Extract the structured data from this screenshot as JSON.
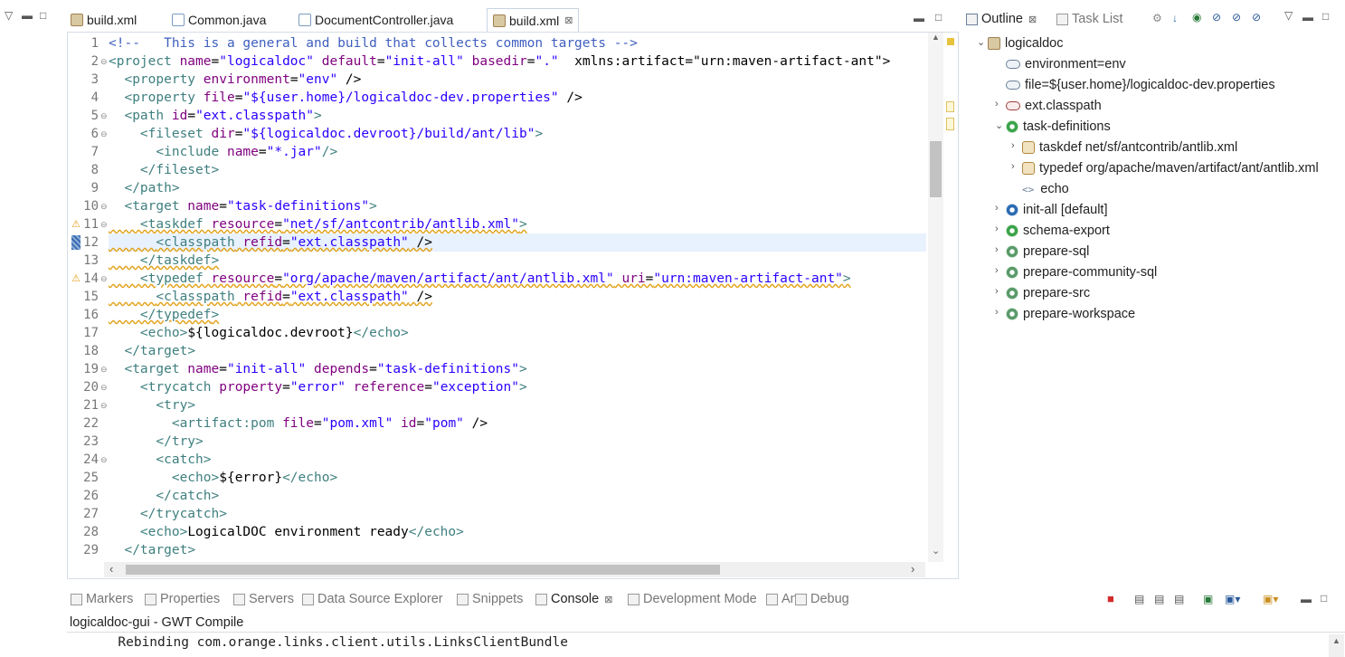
{
  "editor_tabs": [
    {
      "label": "build.xml",
      "icon": "ant-xml-icon"
    },
    {
      "label": "Common.java",
      "icon": "java-file-icon"
    },
    {
      "label": "DocumentController.java",
      "icon": "java-file-icon"
    },
    {
      "label": "build.xml",
      "icon": "ant-xml-icon",
      "active": true,
      "close": "⊠"
    }
  ],
  "line_numbers": [
    "1",
    "2",
    "3",
    "4",
    "5",
    "6",
    "7",
    "8",
    "9",
    "10",
    "11",
    "12",
    "13",
    "14",
    "15",
    "16",
    "17",
    "18",
    "19",
    "20",
    "21",
    "22",
    "23",
    "24",
    "25",
    "26",
    "27",
    "28",
    "29"
  ],
  "code_lines": [
    "<!--   This is a general and build that collects common targets -->",
    "<project name=\"logicaldoc\" default=\"init-all\" basedir=\".\"  xmlns:artifact=\"urn:maven-artifact-ant\">",
    "  <property environment=\"env\" />",
    "  <property file=\"${user.home}/logicaldoc-dev.properties\" />",
    "  <path id=\"ext.classpath\">",
    "    <fileset dir=\"${logicaldoc.devroot}/build/ant/lib\">",
    "      <include name=\"*.jar\"/>",
    "    </fileset>",
    "  </path>",
    "  <target name=\"task-definitions\">",
    "    <taskdef resource=\"net/sf/antcontrib/antlib.xml\">",
    "      <classpath refid=\"ext.classpath\" />",
    "    </taskdef>",
    "    <typedef resource=\"org/apache/maven/artifact/ant/antlib.xml\" uri=\"urn:maven-artifact-ant\">",
    "      <classpath refid=\"ext.classpath\" />",
    "    </typedef>",
    "    <echo>${logicaldoc.devroot}</echo>",
    "  </target>",
    "  <target name=\"init-all\" depends=\"task-definitions\">",
    "    <trycatch property=\"error\" reference=\"exception\">",
    "      <try>",
    "        <artifact:pom file=\"pom.xml\" id=\"pom\" />",
    "      </try>",
    "      <catch>",
    "        <echo>${error}</echo>",
    "      </catch>",
    "    </trycatch>",
    "    <echo>LogicalDOC environment ready</echo>",
    "  </target>"
  ],
  "outline": {
    "tab_label": "Outline",
    "tab_close": "⊠",
    "task_list_label": "Task List",
    "root": "logicaldoc",
    "items": [
      {
        "label": "environment=env",
        "kind": "property"
      },
      {
        "label": "file=${user.home}/logicaldoc-dev.properties",
        "kind": "property"
      },
      {
        "label": "ext.classpath",
        "kind": "path"
      },
      {
        "label": "task-definitions",
        "kind": "target"
      },
      {
        "label": "taskdef net/sf/antcontrib/antlib.xml",
        "kind": "taskdef"
      },
      {
        "label": "typedef org/apache/maven/artifact/ant/antlib.xml",
        "kind": "typedef"
      },
      {
        "label": "echo",
        "kind": "element"
      },
      {
        "label": "init-all [default]",
        "kind": "default-target"
      },
      {
        "label": "schema-export",
        "kind": "target"
      },
      {
        "label": "prepare-sql",
        "kind": "target"
      },
      {
        "label": "prepare-community-sql",
        "kind": "target"
      },
      {
        "label": "prepare-src",
        "kind": "target"
      },
      {
        "label": "prepare-workspace",
        "kind": "target"
      }
    ]
  },
  "bottom_tabs": [
    {
      "label": "Markers"
    },
    {
      "label": "Properties"
    },
    {
      "label": "Servers"
    },
    {
      "label": "Data Source Explorer"
    },
    {
      "label": "Snippets"
    },
    {
      "label": "Console",
      "active": true,
      "close": "⊠"
    },
    {
      "label": "Development Mode"
    },
    {
      "label": "Ant"
    },
    {
      "label": "Debug"
    }
  ],
  "console": {
    "title": "logicaldoc-gui - GWT Compile",
    "lines": [
      "      Rebinding com.orange.links.client.utils.LinksClientBundle"
    ]
  },
  "colors": {
    "tag": "#3f7f7f",
    "attr": "#7f007f",
    "value": "#2a00ff",
    "comment": "#3f5fbf",
    "warning": "#e3a21a",
    "current_line": "#e8f2fe"
  }
}
